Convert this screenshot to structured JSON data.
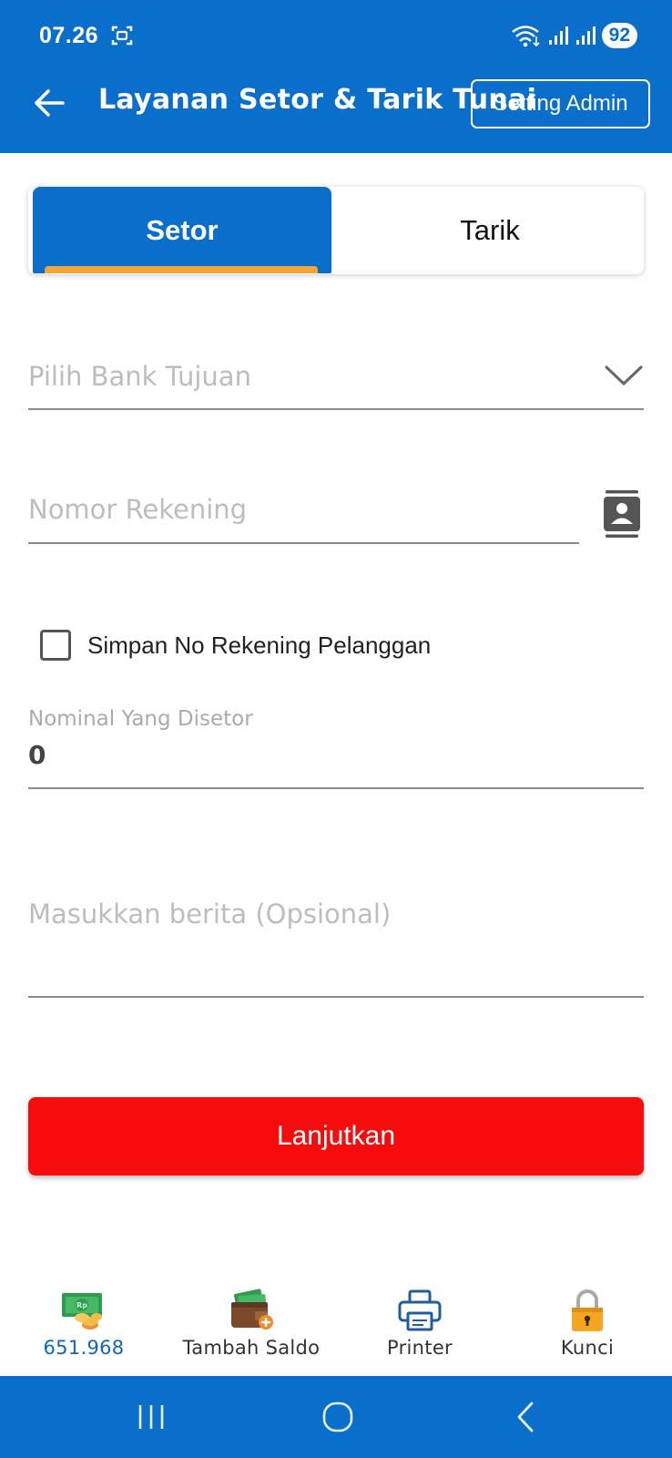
{
  "status_bar": {
    "time": "07.26",
    "battery": "92"
  },
  "header": {
    "title": "Layanan Setor & Tarik Tunai",
    "admin_button": "Setting Admin"
  },
  "tabs": [
    {
      "label": "Setor",
      "active": true
    },
    {
      "label": "Tarik",
      "active": false
    }
  ],
  "form": {
    "bank_placeholder": "Pilih Bank Tujuan",
    "account_placeholder": "Nomor Rekening",
    "save_account_label": "Simpan No Rekening Pelanggan",
    "save_account_checked": false,
    "nominal_label": "Nominal Yang Disetor",
    "nominal_value": "0",
    "message_placeholder": "Masukkan berita (Opsional)",
    "submit_label": "Lanjutkan"
  },
  "bottom_nav": {
    "balance": "651.968",
    "topup": "Tambah Saldo",
    "printer": "Printer",
    "lock": "Kunci"
  },
  "colors": {
    "primary": "#0a6fca",
    "tab_indicator": "#f5a437",
    "submit": "#f60c0c",
    "balance_text": "#1167b5"
  }
}
